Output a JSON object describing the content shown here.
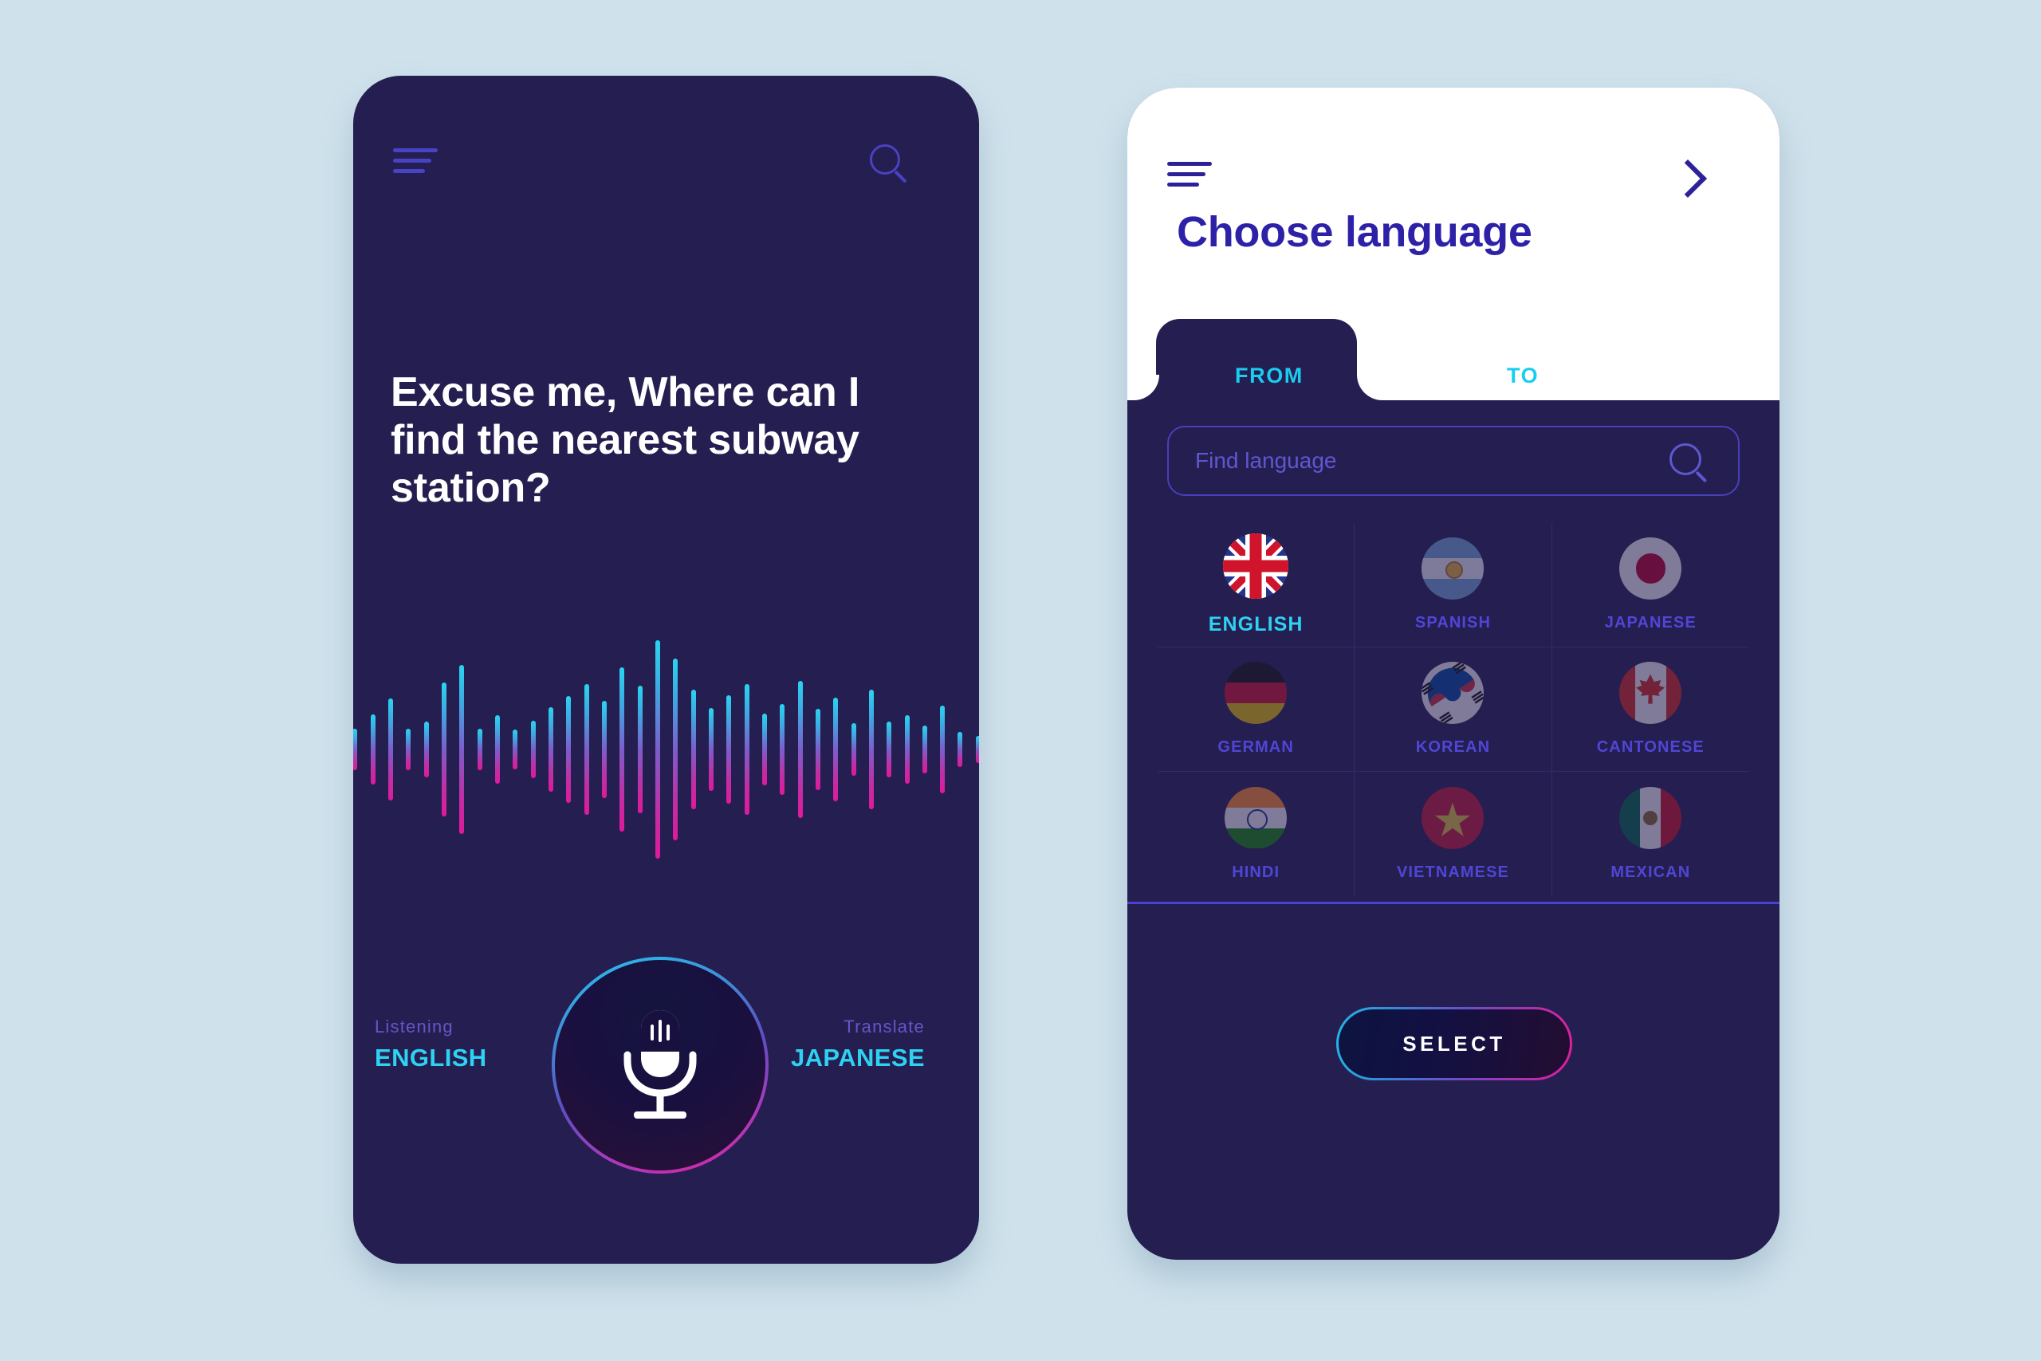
{
  "theme": {
    "page_background": "#cfe2ec",
    "phone_dark": "#251e50",
    "accent_cyan": "#2ed2f2",
    "accent_magenta": "#e0199a",
    "indigo": "#4a42c4",
    "title_blue": "#2d21a8"
  },
  "screen_listen": {
    "menu_icon": "hamburger-icon",
    "search_icon": "search-icon",
    "headline": "Excuse me, Where can I find the nearest subway station?",
    "waveform": {
      "icon": "audio-waveform",
      "bar_heights": [
        28,
        52,
        88,
        128,
        52,
        70,
        168,
        212,
        52,
        86,
        50,
        72,
        106,
        134,
        164,
        122,
        206,
        160,
        274,
        228,
        150,
        104,
        136,
        164,
        90,
        114,
        172,
        102,
        130,
        66,
        150,
        70,
        86,
        60,
        110,
        44,
        34
      ]
    },
    "listening": {
      "caption": "Listening",
      "language": "ENGLISH"
    },
    "translate": {
      "caption": "Translate",
      "language": "JAPANESE"
    },
    "mic_button": {
      "icon": "microphone-icon",
      "label": "Record"
    }
  },
  "screen_choose": {
    "menu_icon": "hamburger-icon",
    "forward_icon": "chevron-right-icon",
    "title": "Choose language",
    "tabs": [
      {
        "label": "FROM",
        "active": true
      },
      {
        "label": "TO",
        "active": false
      }
    ],
    "search": {
      "placeholder": "Find language",
      "value": "",
      "icon": "search-icon"
    },
    "languages": [
      {
        "name": "ENGLISH",
        "flag": "united-kingdom-flag",
        "selected": true
      },
      {
        "name": "SPANISH",
        "flag": "argentina-flag",
        "selected": false
      },
      {
        "name": "JAPANESE",
        "flag": "japan-flag",
        "selected": false
      },
      {
        "name": "GERMAN",
        "flag": "germany-flag",
        "selected": false
      },
      {
        "name": "KOREAN",
        "flag": "south-korea-flag",
        "selected": false
      },
      {
        "name": "CANTONESE",
        "flag": "canada-flag",
        "selected": false
      },
      {
        "name": "HINDI",
        "flag": "india-flag",
        "selected": false
      },
      {
        "name": "VIETNAMESE",
        "flag": "vietnam-flag",
        "selected": false
      },
      {
        "name": "MEXICAN",
        "flag": "mexico-flag",
        "selected": false
      }
    ],
    "select_button": "SELECT"
  }
}
